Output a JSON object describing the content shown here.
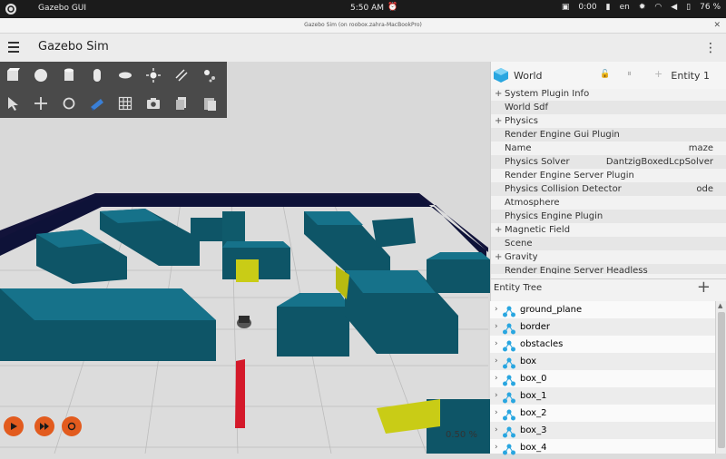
{
  "system_bar": {
    "app_name": "Gazebo GUI",
    "clock": "5:50 AM",
    "timer": "0:00",
    "language": "en",
    "battery": "76 %"
  },
  "window": {
    "title": "Gazebo Sim (on roobox.zahra-MacBookPro)"
  },
  "app_bar": {
    "title": "Gazebo Sim"
  },
  "toolbar": {
    "row1": [
      "box-shape-icon",
      "sphere-shape-icon",
      "cylinder-shape-icon",
      "capsule-shape-icon",
      "ellipsoid-shape-icon",
      "point-light-icon",
      "directional-light-icon",
      "spot-light-icon"
    ],
    "row2": [
      "select-mode-icon",
      "translate-mode-icon",
      "rotate-mode-icon",
      "view-angle-icon",
      "grid-config-icon",
      "screenshot-icon",
      "copy-icon",
      "paste-icon"
    ]
  },
  "component_inspector": {
    "title": "World",
    "entity_label": "Entity 1",
    "rows": [
      {
        "label": "System Plugin Info",
        "expandable": true,
        "value": ""
      },
      {
        "label": "World Sdf",
        "expandable": false,
        "value": ""
      },
      {
        "label": "Physics",
        "expandable": true,
        "value": ""
      },
      {
        "label": "Render Engine Gui Plugin",
        "expandable": false,
        "value": ""
      },
      {
        "label": "Name",
        "expandable": false,
        "value": "maze"
      },
      {
        "label": "Physics Solver",
        "expandable": false,
        "value": "DantzigBoxedLcpSolver"
      },
      {
        "label": "Render Engine Server Plugin",
        "expandable": false,
        "value": ""
      },
      {
        "label": "Physics Collision Detector",
        "expandable": false,
        "value": "ode"
      },
      {
        "label": "Atmosphere",
        "expandable": false,
        "value": ""
      },
      {
        "label": "Physics Engine Plugin",
        "expandable": false,
        "value": ""
      },
      {
        "label": "Magnetic Field",
        "expandable": true,
        "value": ""
      },
      {
        "label": "Scene",
        "expandable": false,
        "value": ""
      },
      {
        "label": "Gravity",
        "expandable": true,
        "value": ""
      },
      {
        "label": "Render Engine Server Headless",
        "expandable": false,
        "value": ""
      }
    ]
  },
  "entity_tree": {
    "title": "Entity Tree",
    "items": [
      "ground_plane",
      "border",
      "obstacles",
      "box",
      "box_0",
      "box_1",
      "box_2",
      "box_3",
      "box_4"
    ]
  },
  "playback": {
    "rtf": "0.50 %"
  },
  "colors": {
    "accent": "#e25b1e",
    "wall": "#0f5a6b",
    "highlight_box": "#c9cc16",
    "red_box": "#d4192a"
  }
}
